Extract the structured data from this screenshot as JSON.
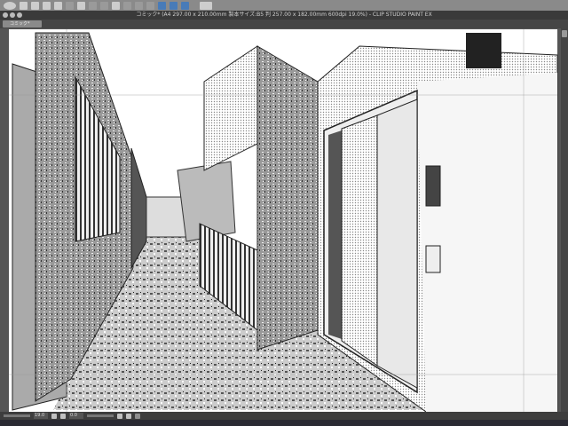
{
  "app": {
    "title": "コミック* (A4 297.00 x 210.00mm 製本サイズ:B5 判 257.00 x 182.00mm 600dpi 19.0%) - CLIP STUDIO PAINT EX"
  },
  "tabs": [
    {
      "label": "コミック*"
    }
  ],
  "toolbar": {
    "icons": [
      "clip-studio-logo",
      "new-file",
      "open-file",
      "save-file",
      "undo",
      "redo",
      "select-all",
      "transform",
      "clear",
      "fit",
      "ruler-snap",
      "perspective-snap",
      "special-ruler-snap",
      "help"
    ]
  },
  "status": {
    "zoom": "19.0",
    "angle": "0.0"
  },
  "colors": {
    "accent": "#3c78c0",
    "titlebar": "#3a3a3a"
  }
}
